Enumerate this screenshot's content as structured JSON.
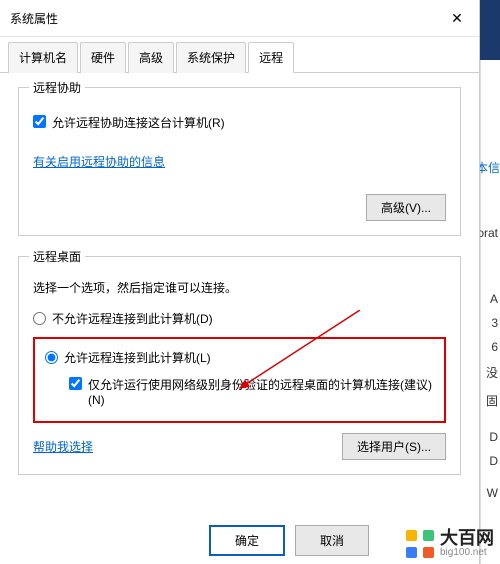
{
  "window": {
    "title": "系统属性",
    "close": "✕"
  },
  "tabs": {
    "items": [
      {
        "label": "计算机名"
      },
      {
        "label": "硬件"
      },
      {
        "label": "高级"
      },
      {
        "label": "系统保护"
      },
      {
        "label": "远程"
      }
    ],
    "active_index": 4
  },
  "remote_assist": {
    "group_title": "远程协助",
    "allow_label": "允许远程协助连接这台计算机(R)",
    "info_link": "有关启用远程协助的信息",
    "advanced_btn": "高级(V)..."
  },
  "remote_desktop": {
    "group_title": "远程桌面",
    "prompt": "选择一个选项，然后指定谁可以连接。",
    "deny_label": "不允许远程连接到此计算机(D)",
    "allow_label": "允许远程连接到此计算机(L)",
    "nla_label": "仅允许运行使用网络级别身份验证的远程桌面的计算机连接(建议)(N)",
    "help_link": "帮助我选择",
    "select_users_btn": "选择用户(S)..."
  },
  "footer": {
    "ok": "确定",
    "cancel": "取消"
  },
  "background": {
    "info_link": "本信",
    "corp": "orporat",
    "a": "A",
    "ver": "3",
    "arch": "6",
    "none": "没",
    "d1": "D",
    "d2": "D",
    "bios": "固",
    "w": "W"
  },
  "watermark": {
    "brand": "大百网",
    "domain": "big100.net"
  }
}
